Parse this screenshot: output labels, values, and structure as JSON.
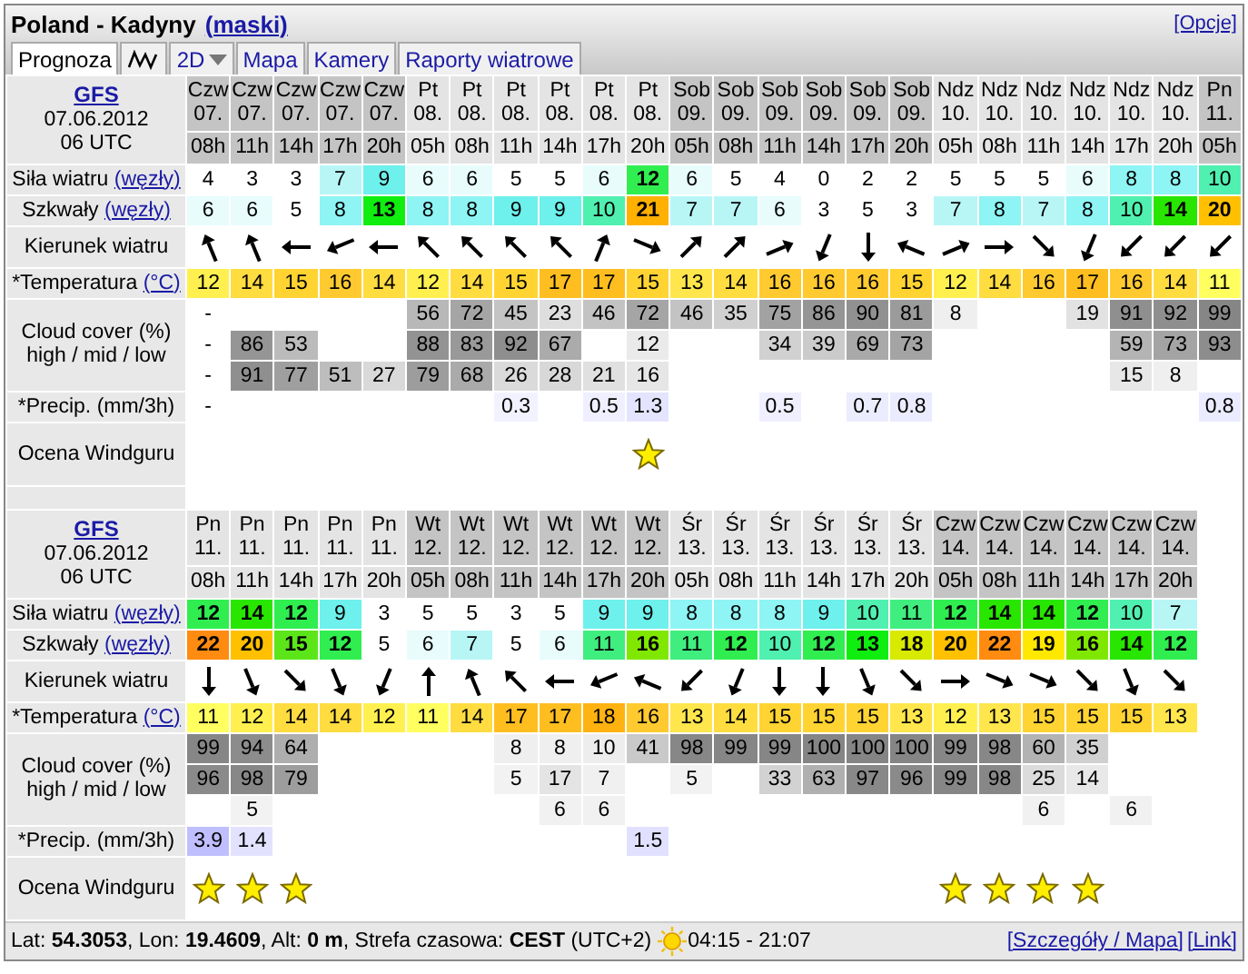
{
  "header": {
    "title": "Poland - Kadyny",
    "title_link": "(maski)",
    "options_link": "[Opcje]"
  },
  "tabs": [
    {
      "kind": "text",
      "label": "Prognoza",
      "selected": true
    },
    {
      "kind": "icon",
      "selected": false
    },
    {
      "kind": "dropdown",
      "label": "2D",
      "selected": false
    },
    {
      "kind": "text",
      "label": "Mapa",
      "selected": false
    },
    {
      "kind": "text",
      "label": "Kamery",
      "selected": false
    },
    {
      "kind": "text",
      "label": "Raporty wiatrowe",
      "selected": false
    }
  ],
  "forecasts": [
    {
      "model": {
        "name": "GFS",
        "date": "07.06.2012",
        "run": "06 UTC"
      },
      "row_labels": {
        "wind": "Siła wiatru",
        "wind_unit": "(węzły)",
        "gust": "Szkwały",
        "gust_unit": "(węzły)",
        "direction": "Kierunek wiatru",
        "temp": "*Temperatura",
        "temp_unit": "(°C)",
        "cloud": "Cloud cover (%)",
        "cloud_levels": "high / mid / low",
        "precip": "*Precip. (mm/3h)",
        "rating": "Ocena Windguru"
      },
      "columns": [
        {
          "day": "Czw",
          "date": "07.",
          "hour": "08h",
          "shaded": true,
          "wind": "4",
          "gust": "6",
          "arrow": {
            "kind": "NNW"
          },
          "temp": "12",
          "cloud_high": "-",
          "cloud_mid": "-",
          "cloud_low": "-",
          "precip": "-",
          "star": false
        },
        {
          "day": "Czw",
          "date": "07.",
          "hour": "11h",
          "shaded": true,
          "wind": "3",
          "gust": "6",
          "arrow": {
            "kind": "NNW"
          },
          "temp": "14",
          "cloud_mid": "86",
          "cloud_low": "91",
          "star": false
        },
        {
          "day": "Czw",
          "date": "07.",
          "hour": "14h",
          "shaded": true,
          "wind": "3",
          "gust": "5",
          "arrow": {
            "kind": "W"
          },
          "temp": "15",
          "cloud_mid": "53",
          "cloud_low": "77",
          "star": false
        },
        {
          "day": "Czw",
          "date": "07.",
          "hour": "17h",
          "shaded": true,
          "wind": "7",
          "gust": "8",
          "arrow": {
            "kind": "WSW"
          },
          "temp": "16",
          "cloud_low": "51",
          "star": false
        },
        {
          "day": "Czw",
          "date": "07.",
          "hour": "20h",
          "shaded": true,
          "wind": "9",
          "gust": "13",
          "arrow": {
            "kind": "W"
          },
          "temp": "14",
          "cloud_low": "27",
          "star": false
        },
        {
          "day": "Pt",
          "date": "08.",
          "hour": "05h",
          "shaded": false,
          "wind": "6",
          "gust": "8",
          "arrow": {
            "kind": "NW"
          },
          "temp": "12",
          "cloud_high": "56",
          "cloud_mid": "88",
          "cloud_low": "79",
          "star": false
        },
        {
          "day": "Pt",
          "date": "08.",
          "hour": "08h",
          "shaded": false,
          "wind": "6",
          "gust": "8",
          "arrow": {
            "kind": "NW"
          },
          "temp": "14",
          "cloud_high": "72",
          "cloud_mid": "83",
          "cloud_low": "68",
          "star": false
        },
        {
          "day": "Pt",
          "date": "08.",
          "hour": "11h",
          "shaded": false,
          "wind": "5",
          "gust": "9",
          "arrow": {
            "kind": "NW"
          },
          "temp": "15",
          "cloud_high": "45",
          "cloud_mid": "92",
          "cloud_low": "26",
          "precip": "0.3",
          "star": false
        },
        {
          "day": "Pt",
          "date": "08.",
          "hour": "14h",
          "shaded": false,
          "wind": "5",
          "gust": "9",
          "arrow": {
            "kind": "NW"
          },
          "temp": "17",
          "cloud_high": "23",
          "cloud_mid": "67",
          "cloud_low": "28",
          "star": false
        },
        {
          "day": "Pt",
          "date": "08.",
          "hour": "17h",
          "shaded": false,
          "wind": "6",
          "gust": "10",
          "arrow": {
            "kind": "NNE"
          },
          "temp": "17",
          "cloud_high": "46",
          "cloud_low": "21",
          "precip": "0.5",
          "star": false
        },
        {
          "day": "Pt",
          "date": "08.",
          "hour": "20h",
          "shaded": false,
          "wind": "12",
          "gust": "21",
          "arrow": {
            "kind": "ESE"
          },
          "temp": "15",
          "cloud_high": "72",
          "cloud_mid": "12",
          "cloud_low": "16",
          "precip": "1.3",
          "star": true
        },
        {
          "day": "Sob",
          "date": "09.",
          "hour": "05h",
          "shaded": true,
          "wind": "6",
          "gust": "7",
          "arrow": {
            "kind": "NE"
          },
          "temp": "13",
          "cloud_high": "46",
          "star": false
        },
        {
          "day": "Sob",
          "date": "09.",
          "hour": "08h",
          "shaded": true,
          "wind": "5",
          "gust": "7",
          "arrow": {
            "kind": "NE"
          },
          "temp": "14",
          "cloud_high": "35",
          "star": false
        },
        {
          "day": "Sob",
          "date": "09.",
          "hour": "11h",
          "shaded": true,
          "wind": "4",
          "gust": "6",
          "arrow": {
            "kind": "ENE"
          },
          "temp": "16",
          "cloud_high": "75",
          "cloud_mid": "34",
          "precip": "0.5",
          "star": false
        },
        {
          "day": "Sob",
          "date": "09.",
          "hour": "14h",
          "shaded": true,
          "wind": "0",
          "gust": "3",
          "arrow": {
            "kind": "SSW"
          },
          "temp": "16",
          "cloud_high": "86",
          "cloud_mid": "39",
          "star": false
        },
        {
          "day": "Sob",
          "date": "09.",
          "hour": "17h",
          "shaded": true,
          "wind": "2",
          "gust": "5",
          "arrow": {
            "kind": "S"
          },
          "temp": "16",
          "cloud_high": "90",
          "cloud_mid": "69",
          "precip": "0.7",
          "star": false
        },
        {
          "day": "Sob",
          "date": "09.",
          "hour": "20h",
          "shaded": true,
          "wind": "2",
          "gust": "3",
          "arrow": {
            "kind": "WNW"
          },
          "temp": "15",
          "cloud_high": "81",
          "cloud_mid": "73",
          "precip": "0.8",
          "star": false
        },
        {
          "day": "Ndz",
          "date": "10.",
          "hour": "05h",
          "shaded": false,
          "wind": "5",
          "gust": "7",
          "arrow": {
            "kind": "ENE"
          },
          "temp": "12",
          "cloud_high": "8",
          "star": false
        },
        {
          "day": "Ndz",
          "date": "10.",
          "hour": "08h",
          "shaded": false,
          "wind": "5",
          "gust": "8",
          "arrow": {
            "kind": "E"
          },
          "temp": "14",
          "star": false
        },
        {
          "day": "Ndz",
          "date": "10.",
          "hour": "11h",
          "shaded": false,
          "wind": "5",
          "gust": "7",
          "arrow": {
            "kind": "SE"
          },
          "temp": "16",
          "star": false
        },
        {
          "day": "Ndz",
          "date": "10.",
          "hour": "14h",
          "shaded": false,
          "wind": "6",
          "gust": "8",
          "arrow": {
            "kind": "SSW"
          },
          "temp": "17",
          "cloud_high": "19",
          "star": false
        },
        {
          "day": "Ndz",
          "date": "10.",
          "hour": "17h",
          "shaded": false,
          "wind": "8",
          "gust": "10",
          "arrow": {
            "kind": "SW"
          },
          "temp": "16",
          "cloud_high": "91",
          "cloud_mid": "59",
          "cloud_low": "15",
          "star": false
        },
        {
          "day": "Ndz",
          "date": "10.",
          "hour": "20h",
          "shaded": false,
          "wind": "8",
          "gust": "14",
          "arrow": {
            "kind": "SW"
          },
          "temp": "14",
          "cloud_high": "92",
          "cloud_mid": "73",
          "cloud_low": "8",
          "star": false
        },
        {
          "day": "Pn",
          "date": "11.",
          "hour": "05h",
          "shaded": true,
          "wind": "10",
          "gust": "20",
          "arrow": {
            "kind": "SW"
          },
          "temp": "11",
          "cloud_high": "99",
          "cloud_mid": "93",
          "precip": "0.8",
          "star": false
        }
      ]
    },
    {
      "model": {
        "name": "GFS",
        "date": "07.06.2012",
        "run": "06 UTC"
      },
      "row_labels": {
        "wind": "Siła wiatru",
        "wind_unit": "(węzły)",
        "gust": "Szkwały",
        "gust_unit": "(węzły)",
        "direction": "Kierunek wiatru",
        "temp": "*Temperatura",
        "temp_unit": "(°C)",
        "cloud": "Cloud cover (%)",
        "cloud_levels": "high / mid / low",
        "precip": "*Precip. (mm/3h)",
        "rating": "Ocena Windguru"
      },
      "columns": [
        {
          "day": "Pn",
          "date": "11.",
          "hour": "08h",
          "shaded": false,
          "wind": "12",
          "gust": "22",
          "arrow": {
            "kind": "S"
          },
          "temp": "11",
          "cloud_high": "99",
          "cloud_mid": "96",
          "precip": "3.9",
          "star": true
        },
        {
          "day": "Pn",
          "date": "11.",
          "hour": "11h",
          "shaded": false,
          "wind": "14",
          "gust": "20",
          "arrow": {
            "kind": "SSE"
          },
          "temp": "12",
          "cloud_high": "94",
          "cloud_mid": "98",
          "cloud_low": "5",
          "precip": "1.4",
          "star": true
        },
        {
          "day": "Pn",
          "date": "11.",
          "hour": "14h",
          "shaded": false,
          "wind": "12",
          "gust": "15",
          "arrow": {
            "kind": "SE"
          },
          "temp": "14",
          "cloud_high": "64",
          "cloud_mid": "79",
          "star": true
        },
        {
          "day": "Pn",
          "date": "11.",
          "hour": "17h",
          "shaded": false,
          "wind": "9",
          "gust": "12",
          "arrow": {
            "kind": "SSE"
          },
          "temp": "14",
          "star": false
        },
        {
          "day": "Pn",
          "date": "11.",
          "hour": "20h",
          "shaded": false,
          "wind": "3",
          "gust": "5",
          "arrow": {
            "kind": "SSW"
          },
          "temp": "12",
          "star": false
        },
        {
          "day": "Wt",
          "date": "12.",
          "hour": "05h",
          "shaded": true,
          "wind": "5",
          "gust": "6",
          "arrow": {
            "kind": "N"
          },
          "temp": "11",
          "star": false
        },
        {
          "day": "Wt",
          "date": "12.",
          "hour": "08h",
          "shaded": true,
          "wind": "5",
          "gust": "7",
          "arrow": {
            "kind": "NNW"
          },
          "temp": "14",
          "star": false
        },
        {
          "day": "Wt",
          "date": "12.",
          "hour": "11h",
          "shaded": true,
          "wind": "3",
          "gust": "5",
          "arrow": {
            "kind": "NW"
          },
          "temp": "17",
          "cloud_high": "8",
          "cloud_mid": "5",
          "star": false
        },
        {
          "day": "Wt",
          "date": "12.",
          "hour": "14h",
          "shaded": true,
          "wind": "5",
          "gust": "6",
          "arrow": {
            "kind": "W"
          },
          "temp": "17",
          "cloud_high": "8",
          "cloud_mid": "17",
          "cloud_low": "6",
          "star": false
        },
        {
          "day": "Wt",
          "date": "12.",
          "hour": "17h",
          "shaded": true,
          "wind": "9",
          "gust": "11",
          "arrow": {
            "kind": "WSW"
          },
          "temp": "18",
          "cloud_high": "10",
          "cloud_mid": "7",
          "cloud_low": "6",
          "star": false
        },
        {
          "day": "Wt",
          "date": "12.",
          "hour": "20h",
          "shaded": true,
          "wind": "9",
          "gust": "16",
          "arrow": {
            "kind": "WNW"
          },
          "temp": "16",
          "cloud_high": "41",
          "precip": "1.5",
          "star": false
        },
        {
          "day": "Śr",
          "date": "13.",
          "hour": "05h",
          "shaded": false,
          "wind": "8",
          "gust": "11",
          "arrow": {
            "kind": "SW"
          },
          "temp": "13",
          "cloud_high": "98",
          "cloud_mid": "5",
          "star": false
        },
        {
          "day": "Śr",
          "date": "13.",
          "hour": "08h",
          "shaded": false,
          "wind": "8",
          "gust": "12",
          "arrow": {
            "kind": "SSW"
          },
          "temp": "14",
          "cloud_high": "99",
          "star": false
        },
        {
          "day": "Śr",
          "date": "13.",
          "hour": "11h",
          "shaded": false,
          "wind": "8",
          "gust": "10",
          "arrow": {
            "kind": "S"
          },
          "temp": "15",
          "cloud_high": "99",
          "cloud_mid": "33",
          "star": false
        },
        {
          "day": "Śr",
          "date": "13.",
          "hour": "14h",
          "shaded": false,
          "wind": "9",
          "gust": "12",
          "arrow": {
            "kind": "S"
          },
          "temp": "15",
          "cloud_high": "100",
          "cloud_mid": "63",
          "star": false
        },
        {
          "day": "Śr",
          "date": "13.",
          "hour": "17h",
          "shaded": false,
          "wind": "10",
          "gust": "13",
          "arrow": {
            "kind": "SSE"
          },
          "temp": "15",
          "cloud_high": "100",
          "cloud_mid": "97",
          "star": false
        },
        {
          "day": "Śr",
          "date": "13.",
          "hour": "20h",
          "shaded": false,
          "wind": "11",
          "gust": "18",
          "arrow": {
            "kind": "SE"
          },
          "temp": "13",
          "cloud_high": "100",
          "cloud_mid": "96",
          "star": false
        },
        {
          "day": "Czw",
          "date": "14.",
          "hour": "05h",
          "shaded": true,
          "wind": "12",
          "gust": "20",
          "arrow": {
            "kind": "E"
          },
          "temp": "12",
          "cloud_high": "99",
          "cloud_mid": "99",
          "star": true
        },
        {
          "day": "Czw",
          "date": "14.",
          "hour": "08h",
          "shaded": true,
          "wind": "14",
          "gust": "22",
          "arrow": {
            "kind": "ESE"
          },
          "temp": "13",
          "cloud_high": "98",
          "cloud_mid": "98",
          "star": true
        },
        {
          "day": "Czw",
          "date": "14.",
          "hour": "11h",
          "shaded": true,
          "wind": "14",
          "gust": "19",
          "arrow": {
            "kind": "ESE"
          },
          "temp": "15",
          "cloud_high": "60",
          "cloud_mid": "25",
          "cloud_low": "6",
          "star": true
        },
        {
          "day": "Czw",
          "date": "14.",
          "hour": "14h",
          "shaded": true,
          "wind": "12",
          "gust": "16",
          "arrow": {
            "kind": "SE"
          },
          "temp": "15",
          "cloud_high": "35",
          "cloud_mid": "14",
          "star": true
        },
        {
          "day": "Czw",
          "date": "14.",
          "hour": "17h",
          "shaded": true,
          "wind": "10",
          "gust": "14",
          "arrow": {
            "kind": "SSE"
          },
          "temp": "15",
          "cloud_low": "6",
          "star": false
        },
        {
          "day": "Czw",
          "date": "14.",
          "hour": "20h",
          "shaded": true,
          "wind": "7",
          "gust": "12",
          "arrow": {
            "kind": "SE"
          },
          "temp": "13",
          "star": false
        }
      ]
    }
  ],
  "footer": {
    "location": "Lat: **54.3053**, Lon: **19.4609**, Alt: **0 m**, Strefa czasowa: **CEST** (UTC+2)",
    "sun_times": "04:15 - 21:07",
    "links": [
      "[Szczegóły / Mapa]",
      "[Link]"
    ]
  }
}
